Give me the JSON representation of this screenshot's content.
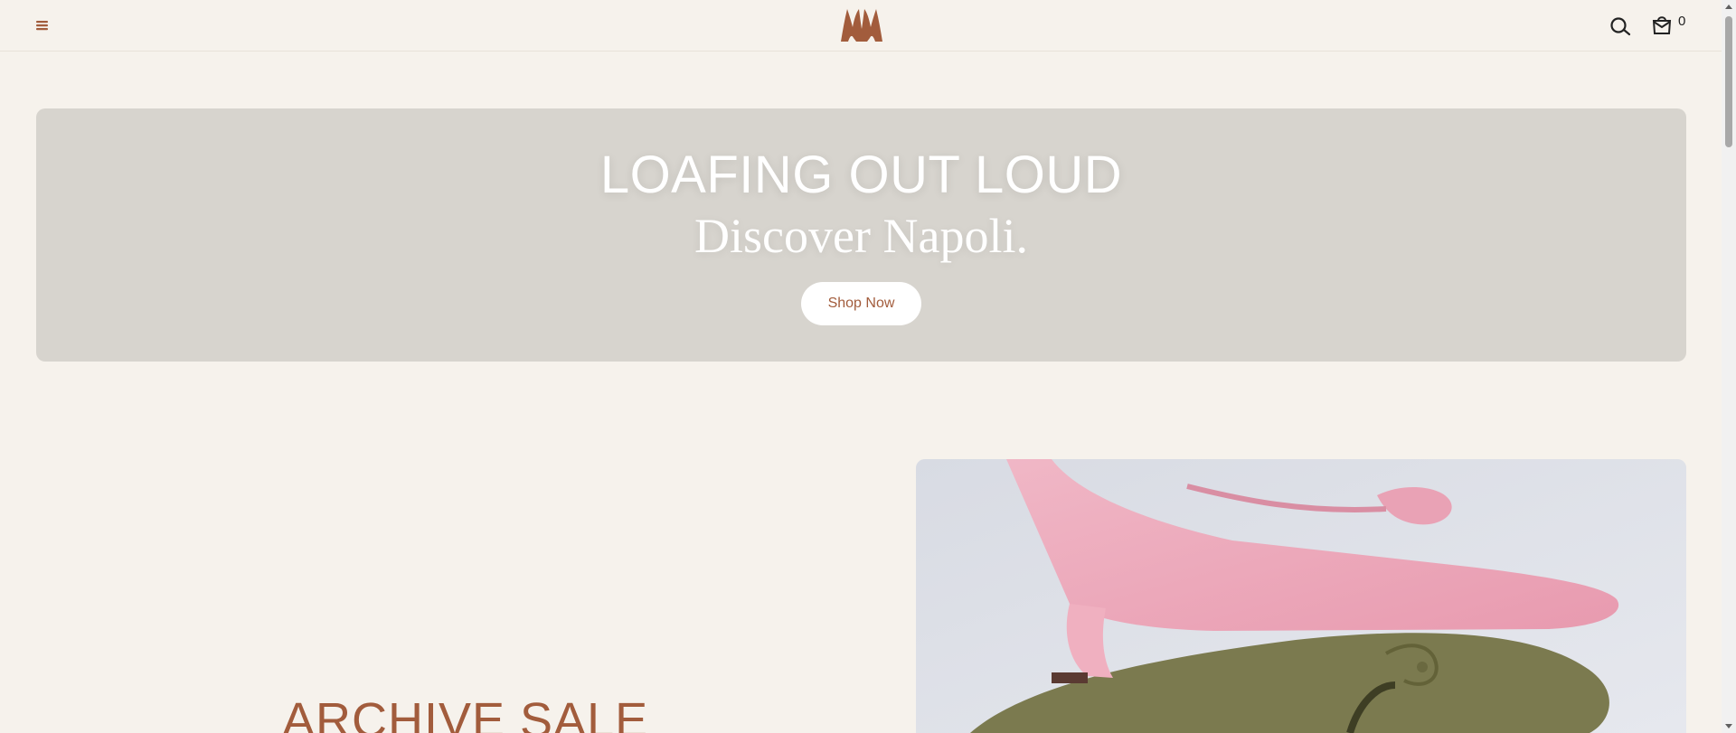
{
  "header": {
    "menu_icon": "hamburger-menu-icon",
    "logo_icon": "brand-logo-icon",
    "search_icon": "search-icon",
    "cart_icon": "shopping-bag-icon",
    "cart_count": "0"
  },
  "hero": {
    "title": "LOAFING OUT LOUD",
    "subtitle": "Discover Napoli.",
    "cta_label": "Shop Now"
  },
  "archive": {
    "title": "ARCHIVE SALE"
  },
  "colors": {
    "brand": "#a25c3c",
    "background": "#f6f2ec",
    "hero_bg": "#d7d4ce"
  }
}
